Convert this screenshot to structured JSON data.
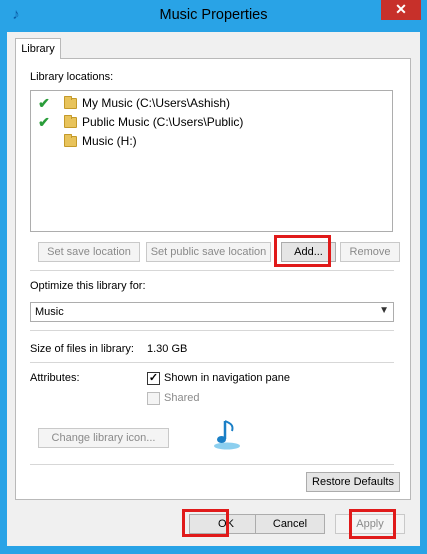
{
  "window": {
    "title": "Music Properties",
    "close_glyph": "✕",
    "app_icon": "music-note-icon"
  },
  "tabs": [
    {
      "label": "Library",
      "selected": true
    }
  ],
  "library_locations": {
    "label": "Library locations:",
    "items": [
      {
        "text": "My Music (C:\\Users\\Ashish)",
        "mark": "✔"
      },
      {
        "text": "Public Music (C:\\Users\\Public)",
        "mark": "✔"
      },
      {
        "text": "Music (H:)",
        "mark": ""
      }
    ]
  },
  "location_buttons": {
    "set_save": "Set save location",
    "set_public_save": "Set public save location",
    "add": "Add...",
    "remove": "Remove"
  },
  "optimize": {
    "label": "Optimize this library for:",
    "value": "Music"
  },
  "size": {
    "label": "Size of files in library:",
    "value": "1.30 GB"
  },
  "attributes": {
    "label": "Attributes:",
    "shown_in_nav": {
      "label": "Shown in navigation pane",
      "checked": true
    },
    "shared": {
      "label": "Shared",
      "checked": false,
      "enabled": false
    }
  },
  "change_icon_button": "Change library icon...",
  "restore_defaults_button": "Restore Defaults",
  "dialog_buttons": {
    "ok": "OK",
    "cancel": "Cancel",
    "apply": "Apply"
  },
  "highlight_color": "#e01a1a",
  "title_bar_color": "#29a3e6"
}
